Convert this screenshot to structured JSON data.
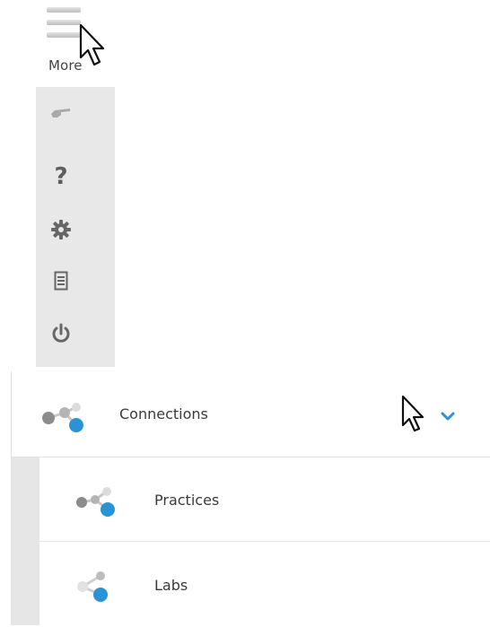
{
  "menu": {
    "more_label": "More"
  },
  "toolbar": {
    "icons": [
      "pointing-hand-icon",
      "help-icon",
      "gear-icon",
      "document-icon",
      "power-icon"
    ],
    "help_glyph": "?"
  },
  "nav": {
    "connections": {
      "label": "Connections",
      "icon": "connections-molecule-icon",
      "expanded": true
    },
    "sub_items": [
      {
        "label": "Practices",
        "icon": "practices-molecule-icon"
      },
      {
        "label": "Labs",
        "icon": "labs-molecule-icon"
      }
    ]
  },
  "colors": {
    "accent_blue": "#2a93d5",
    "strip_gray": "#e8e8e8",
    "icon_gray": "#6d6d6d"
  }
}
